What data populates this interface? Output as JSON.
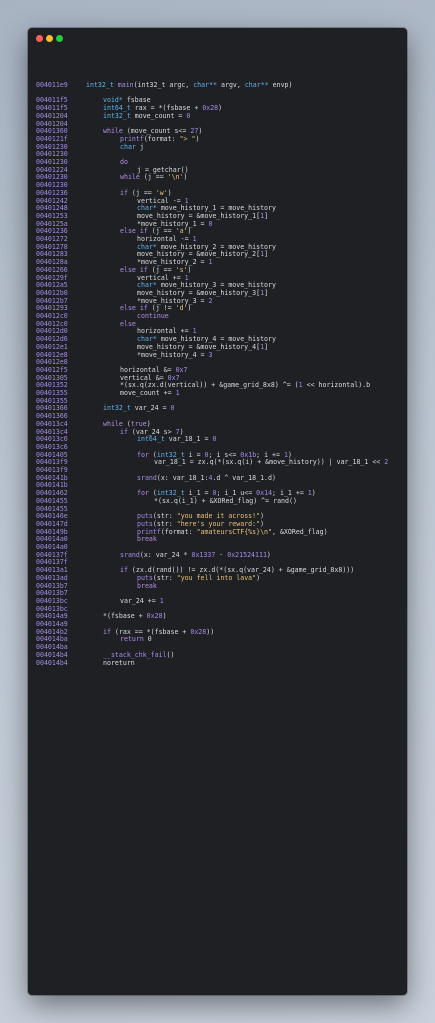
{
  "window": {
    "buttons": [
      "close",
      "minimize",
      "maximize"
    ],
    "colors": {
      "background": "#1e2023",
      "address": "#a58be8",
      "keyword": "#b48ee8",
      "type": "#5fb3f0",
      "string": "#e6c07b",
      "text": "#d7dbe0"
    }
  },
  "code_lines": [
    {
      "addr": "004011e9",
      "indent": 0,
      "parts": [
        [
          "int32_t ",
          "ty"
        ],
        [
          "main",
          "fn"
        ],
        [
          "(int32_t argc, ",
          ""
        ],
        [
          "char**",
          "ty"
        ],
        [
          " argv, ",
          ""
        ],
        [
          "char**",
          "ty"
        ],
        [
          " envp)",
          ""
        ]
      ]
    },
    {
      "addr": "",
      "indent": 0,
      "parts": []
    },
    {
      "addr": "004011f5",
      "indent": 1,
      "parts": [
        [
          "void*",
          "ty"
        ],
        [
          " fsbase",
          ""
        ]
      ]
    },
    {
      "addr": "004011f5",
      "indent": 1,
      "parts": [
        [
          "int64_t",
          "ty"
        ],
        [
          " rax = *(fsbase + ",
          ""
        ],
        [
          "0x28",
          "num"
        ],
        [
          ")",
          ""
        ]
      ]
    },
    {
      "addr": "00401204",
      "indent": 1,
      "parts": [
        [
          "int32_t",
          "ty"
        ],
        [
          " move_count = ",
          ""
        ],
        [
          "0",
          "num"
        ]
      ]
    },
    {
      "addr": "00401204",
      "indent": 0,
      "parts": []
    },
    {
      "addr": "00401360",
      "indent": 1,
      "parts": [
        [
          "while",
          "kw"
        ],
        [
          " (move_count s<= ",
          ""
        ],
        [
          "27",
          "num"
        ],
        [
          ")",
          ""
        ]
      ]
    },
    {
      "addr": "0040121f",
      "indent": 2,
      "parts": [
        [
          "printf",
          "fn"
        ],
        [
          "(format: ",
          ""
        ],
        [
          "\"> \"",
          "str"
        ],
        [
          ")",
          ""
        ]
      ]
    },
    {
      "addr": "00401230",
      "indent": 2,
      "parts": [
        [
          "char",
          "ty"
        ],
        [
          " j",
          ""
        ]
      ]
    },
    {
      "addr": "00401230",
      "indent": 0,
      "parts": []
    },
    {
      "addr": "00401230",
      "indent": 2,
      "parts": [
        [
          "do",
          "kw"
        ]
      ]
    },
    {
      "addr": "00401224",
      "indent": 3,
      "parts": [
        [
          "j = getchar()",
          ""
        ]
      ]
    },
    {
      "addr": "00401230",
      "indent": 2,
      "parts": [
        [
          "while",
          "kw"
        ],
        [
          " (j == ",
          ""
        ],
        [
          "'\\n'",
          "str"
        ],
        [
          ")",
          ""
        ]
      ]
    },
    {
      "addr": "00401230",
      "indent": 0,
      "parts": []
    },
    {
      "addr": "00401236",
      "indent": 2,
      "parts": [
        [
          "if",
          "kw"
        ],
        [
          " (j == ",
          ""
        ],
        [
          "'w'",
          "str"
        ],
        [
          ")",
          ""
        ]
      ]
    },
    {
      "addr": "00401242",
      "indent": 3,
      "parts": [
        [
          "vertical -= ",
          ""
        ],
        [
          "1",
          "num"
        ]
      ]
    },
    {
      "addr": "00401248",
      "indent": 3,
      "parts": [
        [
          "char*",
          "ty"
        ],
        [
          " move_history_1 = move_history",
          ""
        ]
      ]
    },
    {
      "addr": "00401253",
      "indent": 3,
      "parts": [
        [
          "move_history = &move_history_1[",
          ""
        ],
        [
          "1",
          "num"
        ],
        [
          "]",
          ""
        ]
      ]
    },
    {
      "addr": "0040125a",
      "indent": 3,
      "parts": [
        [
          "*move_history_1 = ",
          ""
        ],
        [
          "0",
          "num"
        ]
      ]
    },
    {
      "addr": "00401236",
      "indent": 2,
      "parts": [
        [
          "else if",
          "kw"
        ],
        [
          " (j == ",
          ""
        ],
        [
          "'a'",
          "str"
        ],
        [
          ")",
          ""
        ]
      ]
    },
    {
      "addr": "00401272",
      "indent": 3,
      "parts": [
        [
          "horizontal -= ",
          ""
        ],
        [
          "1",
          "num"
        ]
      ]
    },
    {
      "addr": "00401278",
      "indent": 3,
      "parts": [
        [
          "char*",
          "ty"
        ],
        [
          " move_history_2 = move_history",
          ""
        ]
      ]
    },
    {
      "addr": "00401283",
      "indent": 3,
      "parts": [
        [
          "move_history = &move_history_2[",
          ""
        ],
        [
          "1",
          "num"
        ],
        [
          "]",
          ""
        ]
      ]
    },
    {
      "addr": "0040128a",
      "indent": 3,
      "parts": [
        [
          "*move_history_2 = ",
          ""
        ],
        [
          "1",
          "num"
        ]
      ]
    },
    {
      "addr": "00401266",
      "indent": 2,
      "parts": [
        [
          "else if",
          "kw"
        ],
        [
          " (j == ",
          ""
        ],
        [
          "'s'",
          "str"
        ],
        [
          ")",
          ""
        ]
      ]
    },
    {
      "addr": "0040129f",
      "indent": 3,
      "parts": [
        [
          "vertical += ",
          ""
        ],
        [
          "1",
          "num"
        ]
      ]
    },
    {
      "addr": "004012a5",
      "indent": 3,
      "parts": [
        [
          "char*",
          "ty"
        ],
        [
          " move_history_3 = move_history",
          ""
        ]
      ]
    },
    {
      "addr": "004012b0",
      "indent": 3,
      "parts": [
        [
          "move_history = &move_history_3[",
          ""
        ],
        [
          "1",
          "num"
        ],
        [
          "]",
          ""
        ]
      ]
    },
    {
      "addr": "004012b7",
      "indent": 3,
      "parts": [
        [
          "*move_history_3 = ",
          ""
        ],
        [
          "2",
          "num"
        ]
      ]
    },
    {
      "addr": "00401293",
      "indent": 2,
      "parts": [
        [
          "else if",
          "kw"
        ],
        [
          " (j != ",
          ""
        ],
        [
          "'d'",
          "str"
        ],
        [
          ")",
          ""
        ]
      ]
    },
    {
      "addr": "004012c0",
      "indent": 3,
      "parts": [
        [
          "continue",
          "kw"
        ]
      ]
    },
    {
      "addr": "004012c0",
      "indent": 2,
      "parts": [
        [
          "else",
          "kw"
        ]
      ]
    },
    {
      "addr": "004012d0",
      "indent": 3,
      "parts": [
        [
          "horizontal += ",
          ""
        ],
        [
          "1",
          "num"
        ]
      ]
    },
    {
      "addr": "004012d6",
      "indent": 3,
      "parts": [
        [
          "char*",
          "ty"
        ],
        [
          " move_history_4 = move_history",
          ""
        ]
      ]
    },
    {
      "addr": "004012e1",
      "indent": 3,
      "parts": [
        [
          "move_history = &move_history_4[",
          ""
        ],
        [
          "1",
          "num"
        ],
        [
          "]",
          ""
        ]
      ]
    },
    {
      "addr": "004012e8",
      "indent": 3,
      "parts": [
        [
          "*move_history_4 = ",
          ""
        ],
        [
          "3",
          "num"
        ]
      ]
    },
    {
      "addr": "004012e8",
      "indent": 0,
      "parts": []
    },
    {
      "addr": "004012f5",
      "indent": 2,
      "parts": [
        [
          "horizontal &= ",
          ""
        ],
        [
          "0x7",
          "num"
        ]
      ]
    },
    {
      "addr": "00401305",
      "indent": 2,
      "parts": [
        [
          "vertical &= ",
          ""
        ],
        [
          "0x7",
          "num"
        ]
      ]
    },
    {
      "addr": "00401352",
      "indent": 2,
      "parts": [
        [
          "*(sx.q(zx.d(vertical)) + &game_grid_8x8) ^= (",
          ""
        ],
        [
          "1",
          "num"
        ],
        [
          " << horizontal).b",
          ""
        ]
      ]
    },
    {
      "addr": "00401355",
      "indent": 2,
      "parts": [
        [
          "move_count += ",
          ""
        ],
        [
          "1",
          "num"
        ]
      ]
    },
    {
      "addr": "00401355",
      "indent": 0,
      "parts": []
    },
    {
      "addr": "00401366",
      "indent": 1,
      "parts": [
        [
          "int32_t",
          "ty"
        ],
        [
          " var_24 = ",
          ""
        ],
        [
          "0",
          "num"
        ]
      ]
    },
    {
      "addr": "00401366",
      "indent": 0,
      "parts": []
    },
    {
      "addr": "004013c4",
      "indent": 1,
      "parts": [
        [
          "while",
          "kw"
        ],
        [
          " (",
          ""
        ],
        [
          "true",
          "kw"
        ],
        [
          ")",
          ""
        ]
      ]
    },
    {
      "addr": "004013c4",
      "indent": 2,
      "parts": [
        [
          "if",
          "kw"
        ],
        [
          " (var_24 s> ",
          ""
        ],
        [
          "7",
          "num"
        ],
        [
          ")",
          ""
        ]
      ]
    },
    {
      "addr": "004013c6",
      "indent": 3,
      "parts": [
        [
          "int64_t",
          "ty"
        ],
        [
          " var_18_1 = ",
          ""
        ],
        [
          "0",
          "num"
        ]
      ]
    },
    {
      "addr": "004013c6",
      "indent": 0,
      "parts": []
    },
    {
      "addr": "00401405",
      "indent": 3,
      "parts": [
        [
          "for",
          "kw"
        ],
        [
          " (",
          ""
        ],
        [
          "int32_t",
          "ty"
        ],
        [
          " i = ",
          ""
        ],
        [
          "0",
          "num"
        ],
        [
          "; i s<= ",
          ""
        ],
        [
          "0x1b",
          "num"
        ],
        [
          "; i += ",
          ""
        ],
        [
          "1",
          "num"
        ],
        [
          ")",
          ""
        ]
      ]
    },
    {
      "addr": "004013f9",
      "indent": 4,
      "parts": [
        [
          "var_18_1 = zx.q(*(sx.q(i) + &move_history)) | var_18_1 << ",
          ""
        ],
        [
          "2",
          "num"
        ]
      ]
    },
    {
      "addr": "004013f9",
      "indent": 0,
      "parts": []
    },
    {
      "addr": "0040141b",
      "indent": 3,
      "parts": [
        [
          "srand",
          "fn"
        ],
        [
          "(x: var_18_1:",
          ""
        ],
        [
          "4",
          "num"
        ],
        [
          ".d ^ var_18_1.d)",
          ""
        ]
      ]
    },
    {
      "addr": "0040141b",
      "indent": 0,
      "parts": []
    },
    {
      "addr": "00401462",
      "indent": 3,
      "parts": [
        [
          "for",
          "kw"
        ],
        [
          " (",
          ""
        ],
        [
          "int32_t",
          "ty"
        ],
        [
          " i_1 = ",
          ""
        ],
        [
          "0",
          "num"
        ],
        [
          "; i_1 u<= ",
          ""
        ],
        [
          "0x14",
          "num"
        ],
        [
          "; i_1 += ",
          ""
        ],
        [
          "1",
          "num"
        ],
        [
          ")",
          ""
        ]
      ]
    },
    {
      "addr": "00401455",
      "indent": 4,
      "parts": [
        [
          "*(sx.q(i_1) + &XORed_flag) ^= rand()",
          ""
        ]
      ]
    },
    {
      "addr": "00401455",
      "indent": 0,
      "parts": []
    },
    {
      "addr": "0040146e",
      "indent": 3,
      "parts": [
        [
          "puts",
          "fn"
        ],
        [
          "(str: ",
          ""
        ],
        [
          "\"you made it across!\"",
          "str"
        ],
        [
          ")",
          ""
        ]
      ]
    },
    {
      "addr": "0040147d",
      "indent": 3,
      "parts": [
        [
          "puts",
          "fn"
        ],
        [
          "(str: ",
          ""
        ],
        [
          "\"here's your reward:\"",
          "str"
        ],
        [
          ")",
          ""
        ]
      ]
    },
    {
      "addr": "0040149b",
      "indent": 3,
      "parts": [
        [
          "printf",
          "fn"
        ],
        [
          "(format: ",
          ""
        ],
        [
          "\"amateursCTF{%s}\\n\"",
          "str"
        ],
        [
          ", &XORed_flag)",
          ""
        ]
      ]
    },
    {
      "addr": "004014a0",
      "indent": 3,
      "parts": [
        [
          "break",
          "kw"
        ]
      ]
    },
    {
      "addr": "004014a0",
      "indent": 0,
      "parts": []
    },
    {
      "addr": "0040137f",
      "indent": 2,
      "parts": [
        [
          "srand",
          "fn"
        ],
        [
          "(x: var_24 * ",
          ""
        ],
        [
          "0x1337",
          "num"
        ],
        [
          " - ",
          ""
        ],
        [
          "0x21524111",
          "num"
        ],
        [
          ")",
          ""
        ]
      ]
    },
    {
      "addr": "0040137f",
      "indent": 0,
      "parts": []
    },
    {
      "addr": "004013a1",
      "indent": 2,
      "parts": [
        [
          "if",
          "kw"
        ],
        [
          " (zx.d(rand()) != zx.d(*(sx.q(var_24) + &game_grid_8x8)))",
          ""
        ]
      ]
    },
    {
      "addr": "004013ad",
      "indent": 3,
      "parts": [
        [
          "puts",
          "fn"
        ],
        [
          "(str: ",
          ""
        ],
        [
          "\"you fell into lava\"",
          "str"
        ],
        [
          ")",
          ""
        ]
      ]
    },
    {
      "addr": "004013b7",
      "indent": 3,
      "parts": [
        [
          "break",
          "kw"
        ]
      ]
    },
    {
      "addr": "004013b7",
      "indent": 0,
      "parts": []
    },
    {
      "addr": "004013bc",
      "indent": 2,
      "parts": [
        [
          "var_24 += ",
          ""
        ],
        [
          "1",
          "num"
        ]
      ]
    },
    {
      "addr": "004013bc",
      "indent": 0,
      "parts": []
    },
    {
      "addr": "004014a9",
      "indent": 1,
      "parts": [
        [
          "*(fsbase + ",
          ""
        ],
        [
          "0x28",
          "num"
        ],
        [
          ")",
          ""
        ]
      ]
    },
    {
      "addr": "004014a9",
      "indent": 0,
      "parts": []
    },
    {
      "addr": "004014b2",
      "indent": 1,
      "parts": [
        [
          "if",
          "kw"
        ],
        [
          " (rax == *(fsbase + ",
          ""
        ],
        [
          "0x28",
          "num"
        ],
        [
          "))",
          ""
        ]
      ]
    },
    {
      "addr": "004014ba",
      "indent": 2,
      "parts": [
        [
          "return",
          "kw"
        ],
        [
          " 0",
          ""
        ]
      ]
    },
    {
      "addr": "004014ba",
      "indent": 0,
      "parts": []
    },
    {
      "addr": "004014b4",
      "indent": 1,
      "parts": [
        [
          "__stack_chk_fail",
          "fn"
        ],
        [
          "()",
          ""
        ]
      ]
    },
    {
      "addr": "004014b4",
      "indent": 1,
      "parts": [
        [
          "noreturn",
          ""
        ]
      ]
    }
  ]
}
